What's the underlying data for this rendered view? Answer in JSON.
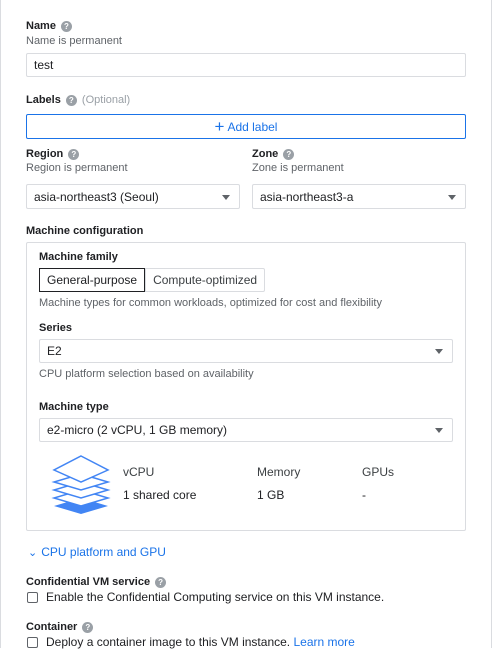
{
  "name": {
    "label": "Name",
    "hint": "Name is permanent",
    "value": "test"
  },
  "labels": {
    "label": "Labels",
    "optional": "(Optional)",
    "add_button": "Add label"
  },
  "region": {
    "label": "Region",
    "hint": "Region is permanent",
    "value": "asia-northeast3 (Seoul)"
  },
  "zone": {
    "label": "Zone",
    "hint": "Zone is permanent",
    "value": "asia-northeast3-a"
  },
  "machine_config": {
    "heading": "Machine configuration",
    "family_label": "Machine family",
    "tabs": [
      "General-purpose",
      "Compute-optimized"
    ],
    "family_desc": "Machine types for common workloads, optimized for cost and flexibility",
    "series_label": "Series",
    "series_value": "E2",
    "series_hint": "CPU platform selection based on availability",
    "type_label": "Machine type",
    "type_value": "e2-micro (2 vCPU, 1 GB memory)",
    "specs": {
      "vcpu_header": "vCPU",
      "memory_header": "Memory",
      "gpus_header": "GPUs",
      "vcpu_value": "1 shared core",
      "memory_value": "1 GB",
      "gpus_value": "-"
    }
  },
  "cpu_platform_link": "CPU platform and GPU",
  "confidential": {
    "label": "Confidential VM service",
    "checkbox_text": "Enable the Confidential Computing service on this VM instance."
  },
  "container": {
    "label": "Container",
    "checkbox_text": "Deploy a container image to this VM instance.",
    "learn_more": "Learn more"
  },
  "colors": {
    "accent": "#1a73e8",
    "icon_blue": "#4285f4",
    "border": "#dadce0"
  }
}
